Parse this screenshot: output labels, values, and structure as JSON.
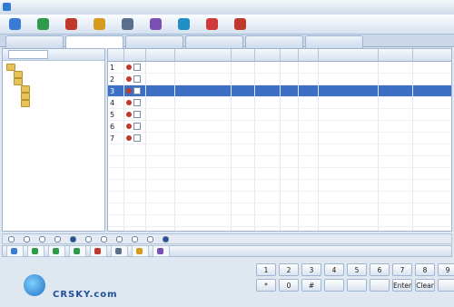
{
  "window": {
    "title": ""
  },
  "toolbar": [
    {
      "label": "",
      "icon": "users-icon",
      "color": "#3a7bd5"
    },
    {
      "label": "",
      "icon": "add-contact-icon",
      "color": "#2f9a4a"
    },
    {
      "label": "",
      "icon": "phone-icon",
      "color": "#c0392b"
    },
    {
      "label": "",
      "icon": "info-icon",
      "color": "#d59a1e"
    },
    {
      "label": "",
      "icon": "gear-icon",
      "color": "#5a6f8c"
    },
    {
      "label": "",
      "icon": "database-icon",
      "color": "#7a4fb3"
    },
    {
      "label": "",
      "icon": "network-icon",
      "color": "#1f8fc4"
    },
    {
      "label": "",
      "icon": "help-icon",
      "color": "#d13a3a"
    },
    {
      "label": "",
      "icon": "exit-icon",
      "color": "#c0392b"
    }
  ],
  "tabs": [
    {
      "label": "",
      "active": false
    },
    {
      "label": "",
      "active": true
    },
    {
      "label": "",
      "active": false
    },
    {
      "label": "",
      "active": false
    },
    {
      "label": "",
      "active": false
    },
    {
      "label": "",
      "active": false
    }
  ],
  "left_panel": {
    "header": "",
    "search_button": "",
    "tree": [
      {
        "label": "",
        "level": 0
      },
      {
        "label": "",
        "level": 1
      },
      {
        "label": "",
        "level": 1
      },
      {
        "label": "",
        "level": 2
      },
      {
        "label": "",
        "level": 2
      },
      {
        "label": "",
        "level": 2
      }
    ]
  },
  "grid": {
    "columns": [
      "",
      "",
      "",
      "",
      "",
      "",
      "",
      "",
      "",
      "",
      "",
      ""
    ],
    "rows": [
      {
        "no": "1",
        "selected": false,
        "cells": [
          "",
          "",
          "",
          "",
          "",
          "",
          "",
          "",
          "",
          ""
        ]
      },
      {
        "no": "2",
        "selected": false,
        "cells": [
          "",
          "",
          "",
          "",
          "",
          "",
          "",
          "",
          "",
          ""
        ]
      },
      {
        "no": "3",
        "selected": true,
        "cells": [
          "",
          "",
          "",
          "",
          "",
          "",
          "",
          "",
          "",
          ""
        ]
      },
      {
        "no": "4",
        "selected": false,
        "cells": [
          "",
          "",
          "",
          "",
          "",
          "",
          "",
          "",
          "",
          ""
        ]
      },
      {
        "no": "5",
        "selected": false,
        "cells": [
          "",
          "",
          "",
          "",
          "",
          "",
          "",
          "",
          "",
          ""
        ]
      },
      {
        "no": "6",
        "selected": false,
        "cells": [
          "",
          "",
          "",
          "",
          "",
          "",
          "",
          "",
          "",
          ""
        ]
      },
      {
        "no": "7",
        "selected": false,
        "cells": [
          "",
          "",
          "",
          "",
          "",
          "",
          "",
          "",
          "",
          ""
        ]
      }
    ]
  },
  "filters": [
    {
      "label": "",
      "on": false
    },
    {
      "label": "",
      "on": false
    },
    {
      "label": "",
      "on": false
    },
    {
      "label": "",
      "on": false
    },
    {
      "label": "",
      "on": true
    },
    {
      "label": "",
      "on": false
    },
    {
      "label": "",
      "on": false
    },
    {
      "label": "",
      "on": false
    },
    {
      "label": "",
      "on": false
    },
    {
      "label": "",
      "on": false
    },
    {
      "label": "",
      "on": true
    }
  ],
  "actions": [
    {
      "label": "",
      "color": "#3a7bd5"
    },
    {
      "label": "",
      "color": "#2f9a4a"
    },
    {
      "label": "",
      "color": "#2f9a4a"
    },
    {
      "label": "",
      "color": "#2f9a4a"
    },
    {
      "label": "",
      "color": "#c0392b"
    },
    {
      "label": "",
      "color": "#5a6f8c"
    },
    {
      "label": "",
      "color": "#d59a1e"
    },
    {
      "label": "",
      "color": "#7a4fb3"
    }
  ],
  "logo": {
    "title": "",
    "subtitle": "CRSKY.com"
  },
  "keypad": {
    "row1": [
      "1",
      "2",
      "3",
      "4",
      "5",
      "6",
      "7",
      "8",
      "9"
    ],
    "row2": [
      "*",
      "0",
      "#",
      "",
      "",
      "",
      "Enter",
      "Clear",
      ""
    ]
  },
  "watermark": {
    "text": ""
  }
}
